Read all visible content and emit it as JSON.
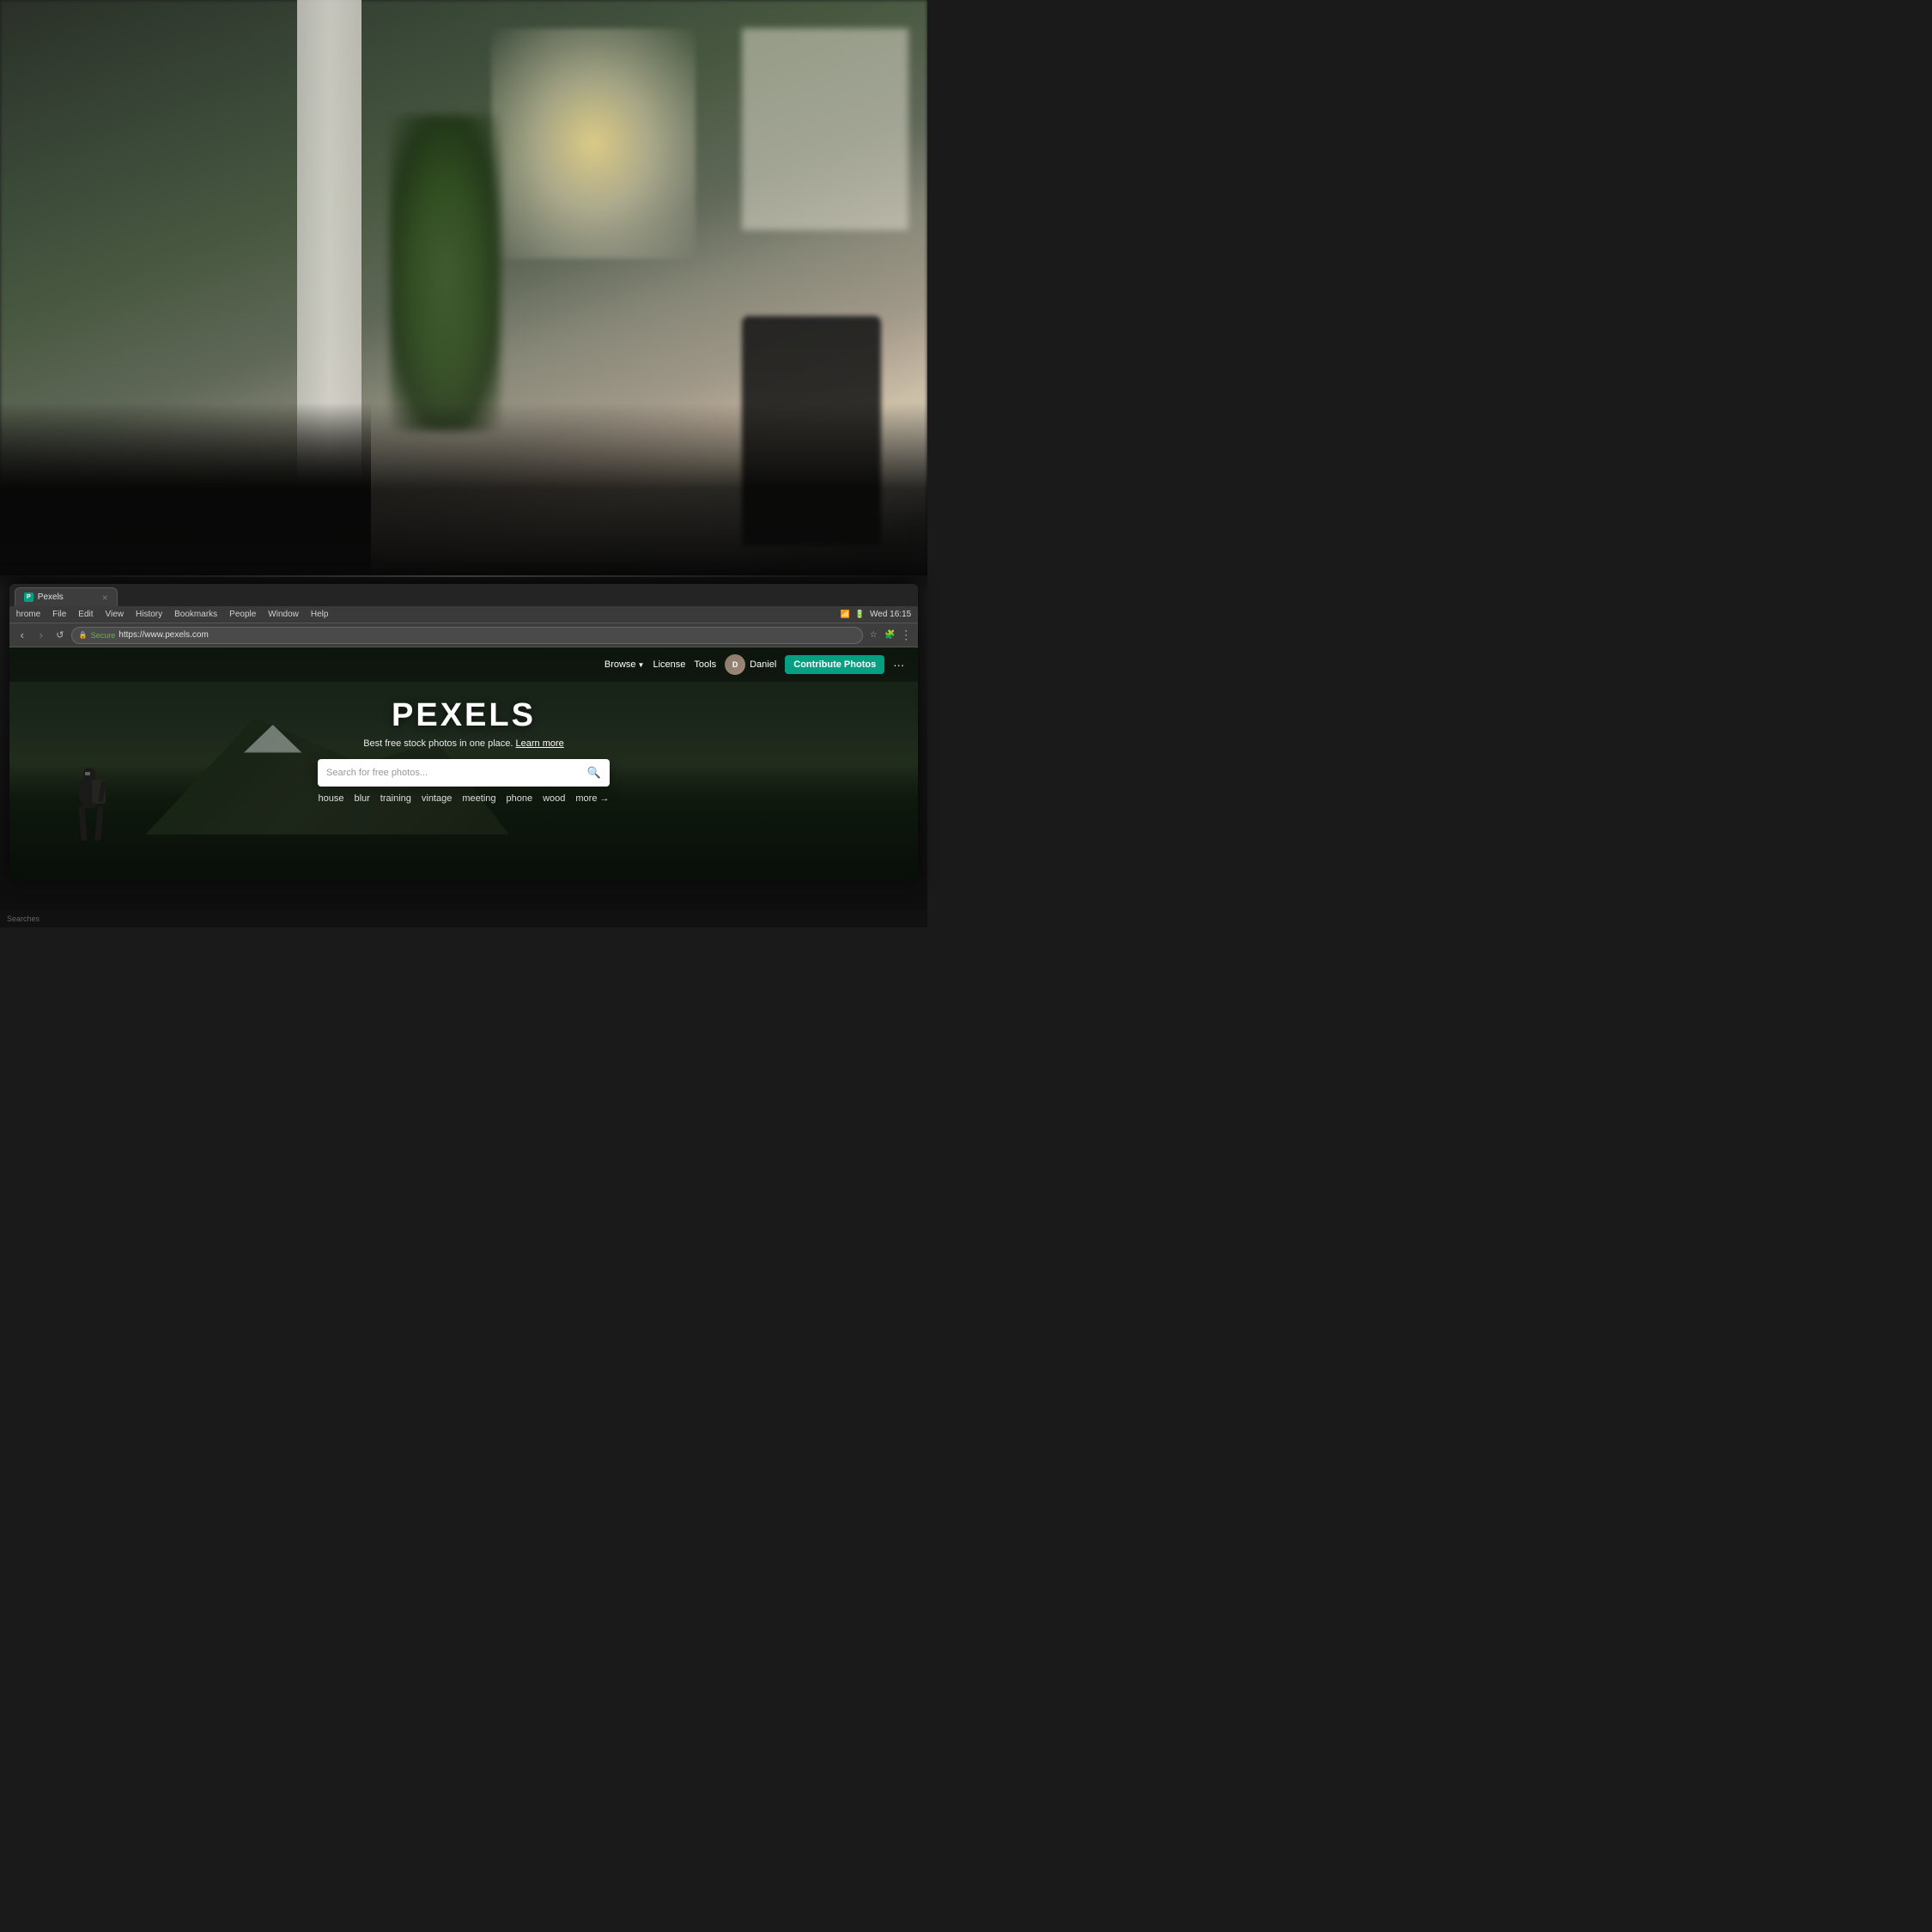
{
  "background": {
    "description": "Blurry office interior with plants, columns, windows and natural light"
  },
  "browser": {
    "menubar": {
      "appName": "hrome",
      "items": [
        "File",
        "Edit",
        "View",
        "History",
        "Bookmarks",
        "People",
        "Window",
        "Help"
      ],
      "rightInfo": "Wed 16:15"
    },
    "toolbar": {
      "secure_label": "Secure",
      "url": "https://www.pexels.com",
      "back_button": "‹",
      "forward_button": "›",
      "refresh_button": "↺"
    },
    "tab": {
      "title": "Pexels",
      "close": "×"
    }
  },
  "pexels": {
    "nav": {
      "browse_label": "Browse",
      "license_label": "License",
      "tools_label": "Tools",
      "user_name": "Daniel",
      "contribute_label": "Contribute Photos",
      "more_icon": "···"
    },
    "hero": {
      "title": "PEXELS",
      "subtitle": "Best free stock photos in one place.",
      "learn_more": "Learn more",
      "search_placeholder": "Search for free photos...",
      "tags": [
        "house",
        "blur",
        "training",
        "vintage",
        "meeting",
        "phone",
        "wood"
      ],
      "more_tag": "more →"
    }
  },
  "status": {
    "bottom_left": "Searches"
  },
  "colors": {
    "contribute_green": "#05a081",
    "nav_bg": "rgba(0,0,0,0.4)",
    "hero_overlay": "rgba(0,0,0,0.3)"
  }
}
